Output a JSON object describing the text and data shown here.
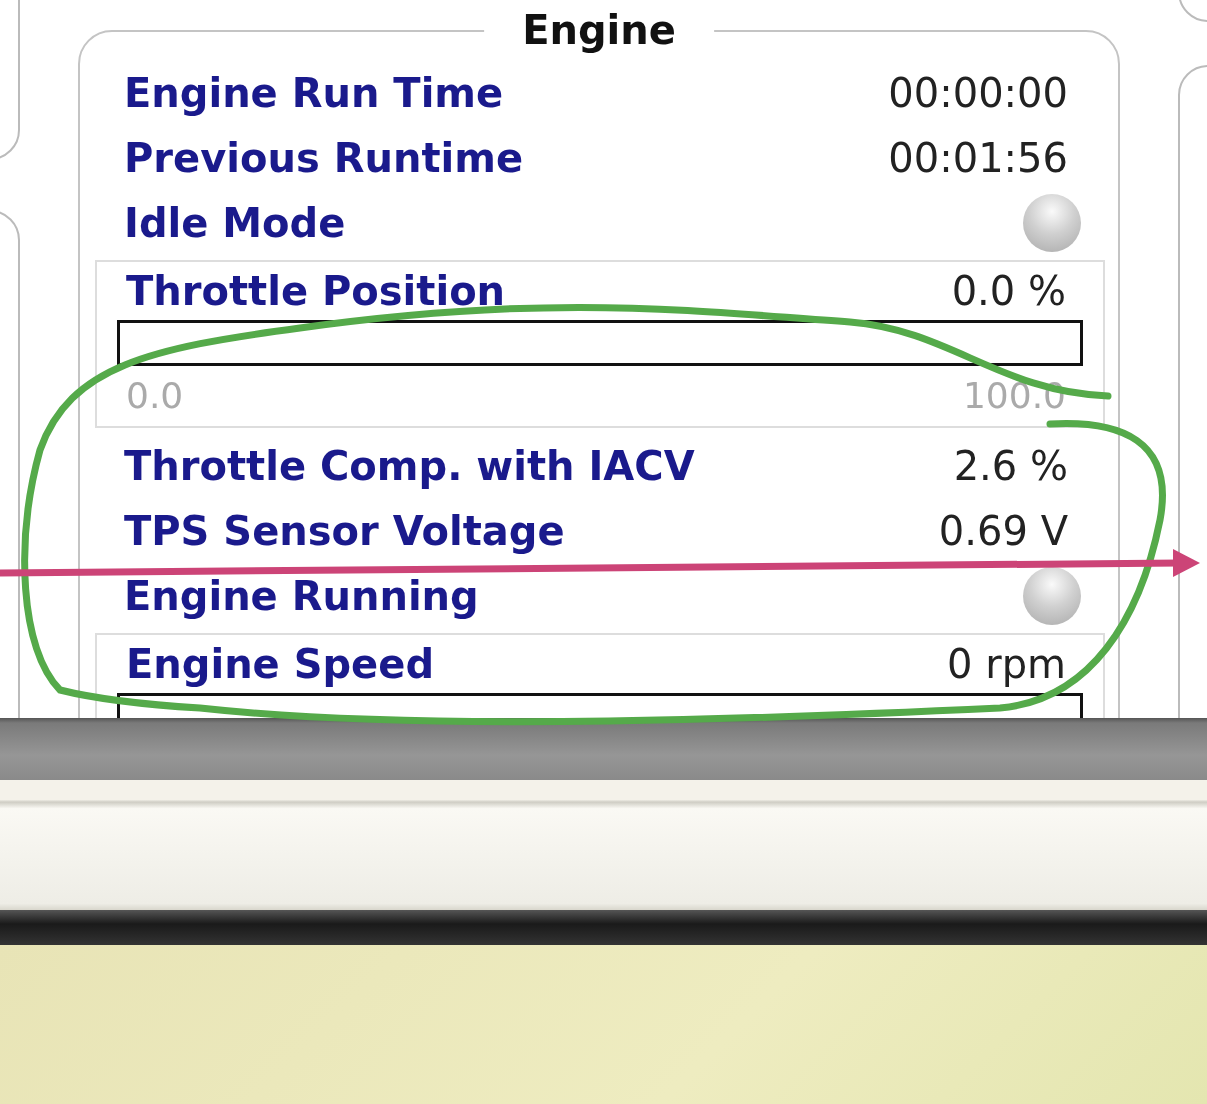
{
  "panel": {
    "title": "Engine",
    "rows": [
      {
        "kind": "value",
        "label": "Engine Run Time",
        "value": "00:00:00"
      },
      {
        "kind": "value",
        "label": "Previous Runtime",
        "value": "00:01:56"
      },
      {
        "kind": "led",
        "label": "Idle Mode",
        "on": false
      },
      {
        "kind": "gauge",
        "label": "Throttle Position",
        "value": "0.0 %",
        "level": 0,
        "min": "0.0",
        "max": "100.0"
      },
      {
        "kind": "value",
        "label": "Throttle Comp. with IACV",
        "value": "2.6 %"
      },
      {
        "kind": "value",
        "label": "TPS Sensor Voltage",
        "value": "0.69 V"
      },
      {
        "kind": "led",
        "label": "Engine Running",
        "on": false
      },
      {
        "kind": "gauge",
        "label": "Engine Speed",
        "value": "0 rpm",
        "level": 0
      }
    ]
  }
}
